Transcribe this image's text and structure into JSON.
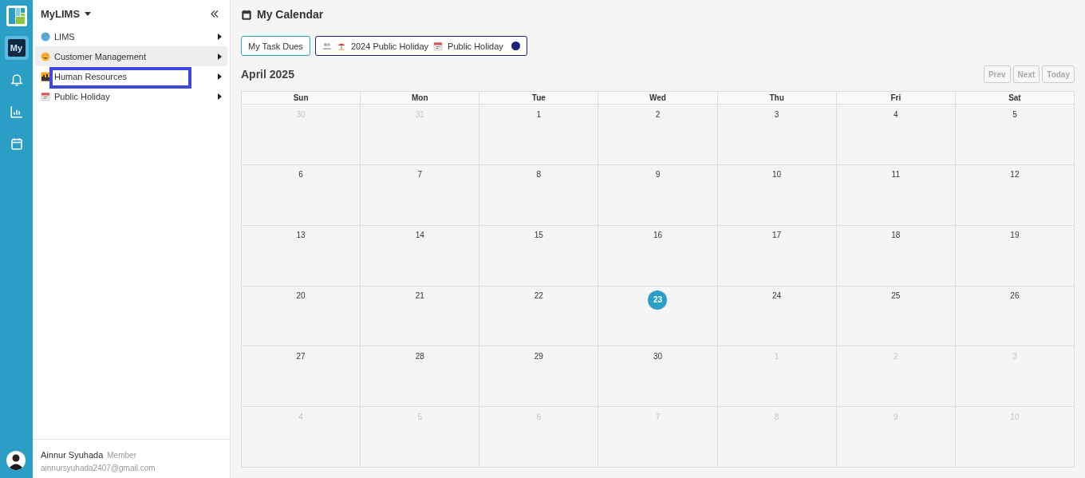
{
  "rail": {
    "items": [
      {
        "kind": "logo",
        "selected": false
      },
      {
        "kind": "my",
        "label": "My",
        "selected": true
      },
      {
        "kind": "bell",
        "selected": false
      },
      {
        "kind": "chart",
        "selected": false
      },
      {
        "kind": "calendar",
        "selected": false
      }
    ]
  },
  "sidebar": {
    "title": "MyLIMS",
    "items": [
      {
        "label": "LIMS",
        "kind": "globe",
        "selected": false
      },
      {
        "label": "Customer Management",
        "kind": "smiley",
        "selected": true
      },
      {
        "label": "Human Resources",
        "kind": "city",
        "selected": false
      },
      {
        "label": "Public Holiday",
        "kind": "calendar",
        "selected": false
      }
    ],
    "user": {
      "name": "Ainnur Syuhada",
      "role": "Member",
      "email": "ainnursyuhada2407@gmail.com"
    }
  },
  "page": {
    "title": "My Calendar"
  },
  "filters": [
    {
      "kind": "button",
      "label": "My Task Dues"
    },
    {
      "kind": "group",
      "items": [
        {
          "kind": "people"
        },
        {
          "kind": "beach",
          "label": "2024 Public Holiday"
        },
        {
          "kind": "calendar",
          "label": "Public Holiday"
        },
        {
          "kind": "dot",
          "color": "#1a237e"
        }
      ]
    }
  ],
  "calendar": {
    "month": "April 2025",
    "buttons": [
      {
        "label": "Prev",
        "disabled": true
      },
      {
        "label": "Next",
        "disabled": true
      },
      {
        "label": "Today",
        "disabled": true
      }
    ],
    "weekdays": [
      "Sun",
      "Mon",
      "Tue",
      "Wed",
      "Thu",
      "Fri",
      "Sat"
    ],
    "weeks": [
      [
        {
          "day": "30",
          "muted": true,
          "today": false
        },
        {
          "day": "31",
          "muted": true,
          "today": false
        },
        {
          "day": "1",
          "muted": false,
          "today": false
        },
        {
          "day": "2",
          "muted": false,
          "today": false
        },
        {
          "day": "3",
          "muted": false,
          "today": false
        },
        {
          "day": "4",
          "muted": false,
          "today": false
        },
        {
          "day": "5",
          "muted": false,
          "today": false
        }
      ],
      [
        {
          "day": "6",
          "muted": false,
          "today": false
        },
        {
          "day": "7",
          "muted": false,
          "today": false
        },
        {
          "day": "8",
          "muted": false,
          "today": false
        },
        {
          "day": "9",
          "muted": false,
          "today": false
        },
        {
          "day": "10",
          "muted": false,
          "today": false
        },
        {
          "day": "11",
          "muted": false,
          "today": false
        },
        {
          "day": "12",
          "muted": false,
          "today": false
        }
      ],
      [
        {
          "day": "13",
          "muted": false,
          "today": false
        },
        {
          "day": "14",
          "muted": false,
          "today": false
        },
        {
          "day": "15",
          "muted": false,
          "today": false
        },
        {
          "day": "16",
          "muted": false,
          "today": false
        },
        {
          "day": "17",
          "muted": false,
          "today": false
        },
        {
          "day": "18",
          "muted": false,
          "today": false
        },
        {
          "day": "19",
          "muted": false,
          "today": false
        }
      ],
      [
        {
          "day": "20",
          "muted": false,
          "today": false
        },
        {
          "day": "21",
          "muted": false,
          "today": false
        },
        {
          "day": "22",
          "muted": false,
          "today": false
        },
        {
          "day": "23",
          "muted": false,
          "today": true
        },
        {
          "day": "24",
          "muted": false,
          "today": false
        },
        {
          "day": "25",
          "muted": false,
          "today": false
        },
        {
          "day": "26",
          "muted": false,
          "today": false
        }
      ],
      [
        {
          "day": "27",
          "muted": false,
          "today": false
        },
        {
          "day": "28",
          "muted": false,
          "today": false
        },
        {
          "day": "29",
          "muted": false,
          "today": false
        },
        {
          "day": "30",
          "muted": false,
          "today": false
        },
        {
          "day": "1",
          "muted": true,
          "today": false
        },
        {
          "day": "2",
          "muted": true,
          "today": false
        },
        {
          "day": "3",
          "muted": true,
          "today": false
        }
      ],
      [
        {
          "day": "4",
          "muted": true,
          "today": false
        },
        {
          "day": "5",
          "muted": true,
          "today": false
        },
        {
          "day": "6",
          "muted": true,
          "today": false
        },
        {
          "day": "7",
          "muted": true,
          "today": false
        },
        {
          "day": "8",
          "muted": true,
          "today": false
        },
        {
          "day": "9",
          "muted": true,
          "today": false
        },
        {
          "day": "10",
          "muted": true,
          "today": false
        }
      ]
    ]
  },
  "annotation": {
    "kind": "highlight-box"
  }
}
